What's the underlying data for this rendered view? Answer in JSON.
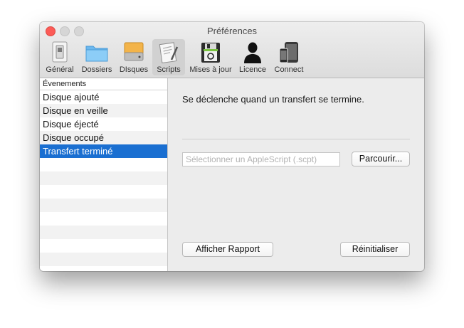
{
  "window": {
    "title": "Préférences"
  },
  "toolbar": {
    "items": [
      {
        "label": "Général",
        "icon": "switch-icon"
      },
      {
        "label": "Dossiers",
        "icon": "folder-icon"
      },
      {
        "label": "DIsques",
        "icon": "disk-icon"
      },
      {
        "label": "Scripts",
        "icon": "script-icon",
        "selected": true
      },
      {
        "label": "Mises à jour",
        "icon": "floppy-update-icon"
      },
      {
        "label": "Licence",
        "icon": "person-icon"
      },
      {
        "label": "Connect",
        "icon": "devices-icon"
      }
    ]
  },
  "sidebar": {
    "header": "Évenements",
    "items": [
      {
        "label": "Disque ajouté"
      },
      {
        "label": "Disque en veille"
      },
      {
        "label": "Disque éjecté"
      },
      {
        "label": "Disque occupé"
      },
      {
        "label": "Transfert terminé",
        "selected": true
      }
    ]
  },
  "main": {
    "description": "Se déclenche quand un transfert se termine.",
    "script_placeholder": "Sélectionner un AppleScript (.scpt)",
    "script_value": "",
    "browse_label": "Parcourir...",
    "show_report_label": "Afficher Rapport",
    "reset_label": "Réinitialiser"
  },
  "colors": {
    "selection": "#1a6fd1",
    "close": "#fc5b57"
  }
}
